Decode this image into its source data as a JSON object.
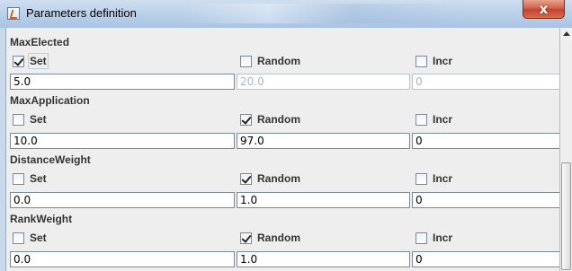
{
  "window": {
    "title": "Parameters definition",
    "close_glyph": "x"
  },
  "sections": [
    {
      "name": "MaxElected",
      "set": {
        "label": "Set",
        "checked": true
      },
      "random": {
        "label": "Random",
        "checked": false
      },
      "incr": {
        "label": "Incr",
        "checked": false
      },
      "fields": [
        "5.0",
        "20.0",
        "0"
      ],
      "disabled": [
        false,
        true,
        true
      ]
    },
    {
      "name": "MaxApplication",
      "set": {
        "label": "Set",
        "checked": false
      },
      "random": {
        "label": "Random",
        "checked": true
      },
      "incr": {
        "label": "Incr",
        "checked": false
      },
      "fields": [
        "10.0",
        "97.0",
        "0"
      ],
      "disabled": [
        false,
        false,
        false
      ]
    },
    {
      "name": "DistanceWeight",
      "set": {
        "label": "Set",
        "checked": false
      },
      "random": {
        "label": "Random",
        "checked": true
      },
      "incr": {
        "label": "Incr",
        "checked": false
      },
      "fields": [
        "0.0",
        "1.0",
        "0"
      ],
      "disabled": [
        false,
        false,
        false
      ]
    },
    {
      "name": "RankWeight",
      "set": {
        "label": "Set",
        "checked": false
      },
      "random": {
        "label": "Random",
        "checked": true
      },
      "incr": {
        "label": "Incr",
        "checked": false
      },
      "fields": [
        "0.0",
        "1.0",
        "0"
      ],
      "disabled": [
        false,
        false,
        false
      ]
    }
  ],
  "colors": {
    "accent": "#c5432a",
    "frame": "#c9d9ec",
    "panel": "#eeeeee"
  }
}
